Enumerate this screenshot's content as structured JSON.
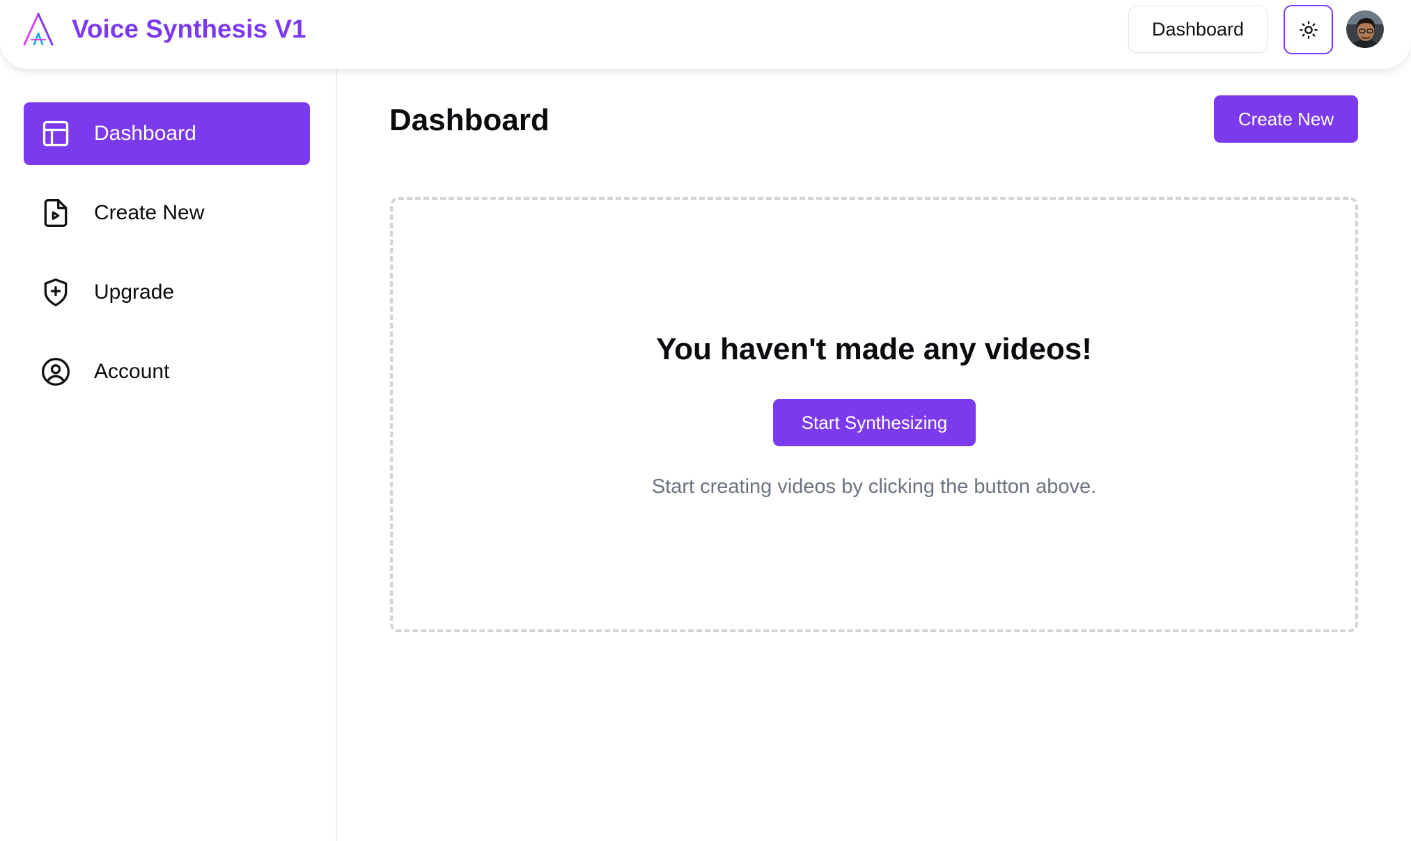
{
  "header": {
    "app_title": "Voice Synthesis V1",
    "dashboard_button": "Dashboard",
    "logo_icon": "triangle-a-logo-icon",
    "theme_icon": "sun-icon",
    "avatar": "user-avatar"
  },
  "sidebar": {
    "items": [
      {
        "label": "Dashboard",
        "icon": "layout-icon",
        "active": true
      },
      {
        "label": "Create New",
        "icon": "file-video-icon",
        "active": false
      },
      {
        "label": "Upgrade",
        "icon": "shield-plus-icon",
        "active": false
      },
      {
        "label": "Account",
        "icon": "user-circle-icon",
        "active": false
      }
    ]
  },
  "main": {
    "title": "Dashboard",
    "create_button": "Create New",
    "empty_state": {
      "heading": "You haven't made any videos!",
      "button": "Start Synthesizing",
      "description": "Start creating videos by clicking the button above."
    }
  },
  "colors": {
    "accent": "#7c3aed",
    "muted_text": "#6b7280",
    "dashed_border": "#d1d5db"
  }
}
